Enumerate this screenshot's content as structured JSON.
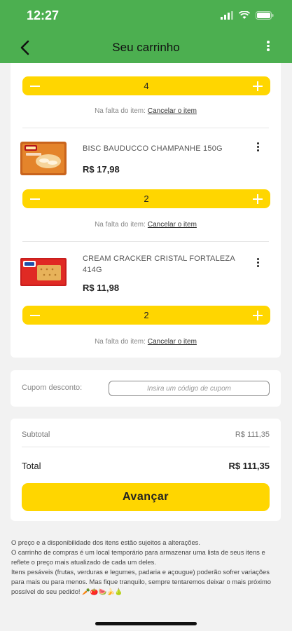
{
  "status_bar": {
    "time": "12:27"
  },
  "header": {
    "title": "Seu carrinho"
  },
  "cart": {
    "missing_label": "Na falta do item:",
    "cancel_label": "Cancelar o item",
    "top_item_qty": "4",
    "items": [
      {
        "name": "BISC BAUDUCCO CHAMPANHE 150G",
        "price": "R$ 17,98",
        "qty": "2"
      },
      {
        "name": "CREAM CRACKER CRISTAL FORTALEZA 414G",
        "price": "R$ 11,98",
        "qty": "2"
      }
    ]
  },
  "coupon": {
    "label": "Cupom desconto:",
    "placeholder": "Insira um código de cupom"
  },
  "summary": {
    "subtotal_label": "Subtotal",
    "subtotal_value": "R$ 111,35",
    "total_label": "Total",
    "total_value": "R$ 111,35",
    "advance_label": "Avançar"
  },
  "disclaimer": "O preço e a disponibilidade dos itens estão sujeitos a alterações.\nO carrinho de compras é um local temporário para armazenar uma lista de seus itens e reflete o preço mais atualizado de cada um deles.\nItens pesáveis (frutas, verduras e legumes, padaria e açougue)  poderão sofrer variações para mais ou para menos. Mas fique tranquilo, sempre tentaremos deixar o mais próximo possível do seu pedido! 🥕🍅🍉🍌🍐",
  "colors": {
    "header": "#4caf50",
    "accent": "#ffd600"
  }
}
